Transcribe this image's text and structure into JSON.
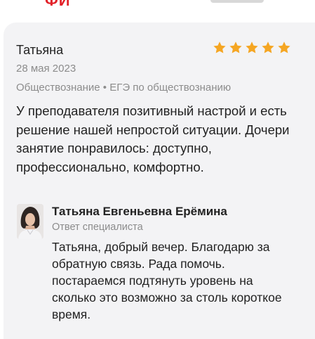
{
  "header": {
    "brand_fragment": "ФИ"
  },
  "review": {
    "author": "Татьяна",
    "rating": 5,
    "rating_max": 5,
    "star_color": "#f5a623",
    "date": "28 мая 2023",
    "tags": "Обществознание • ЕГЭ по обществознанию",
    "text": "У преподавателя позитивный настрой и есть решение нашей непростой ситуации. Дочери занятие понравилось: доступно, профессионально, комфортно."
  },
  "reply": {
    "author": "Татьяна Евгеньевна Ерёмина",
    "role": "Ответ специалиста",
    "text": "Татьяна, добрый вечер. Благодарю за обратную связь. Рада помочь. постараемся подтянуть уровень на сколько это возможно за столь короткое время."
  },
  "colors": {
    "brand_red": "#e2222a",
    "card_bg": "#f3f3f5",
    "muted_text": "#8c8c8c"
  }
}
